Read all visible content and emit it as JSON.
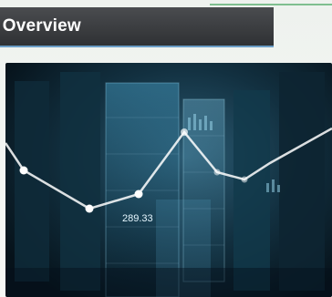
{
  "header": {
    "title": "et Overview"
  },
  "hero_image": {
    "alt_icon": "financial-chart-photo",
    "overlay_value": "289.33"
  },
  "colors": {
    "title_bar": "#3a3c3f",
    "title_underline": "#6b9ec7",
    "accent_line": "#7fbf8f",
    "hero_dark": "#06121a",
    "hero_glow": "#2b5b73"
  }
}
